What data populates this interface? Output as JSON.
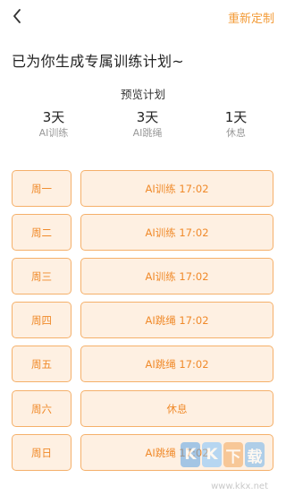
{
  "header": {
    "reset_label": "重新定制"
  },
  "headline": "已为你生成专属训练计划~",
  "preview": {
    "title": "预览计划",
    "stats": [
      {
        "value": "3天",
        "label": "AI训练"
      },
      {
        "value": "3天",
        "label": "AI跳绳"
      },
      {
        "value": "1天",
        "label": "休息"
      }
    ]
  },
  "schedule": [
    {
      "day": "周一",
      "activity": "AI训练 17:02"
    },
    {
      "day": "周二",
      "activity": "AI训练 17:02"
    },
    {
      "day": "周三",
      "activity": "AI训练 17:02"
    },
    {
      "day": "周四",
      "activity": "AI跳绳 17:02"
    },
    {
      "day": "周五",
      "activity": "AI跳绳 17:02"
    },
    {
      "day": "周六",
      "activity": "休息"
    },
    {
      "day": "周日",
      "activity": "AI跳绳 17:02"
    }
  ],
  "watermark": {
    "logo": [
      "K",
      "K",
      "下",
      "载"
    ],
    "url": "www.kkx.net"
  },
  "colors": {
    "accent": "#f39c39",
    "card_bg": "#fef0e2",
    "card_border": "#f5b06a"
  },
  "icons": {
    "back": "chevron-left-icon"
  }
}
